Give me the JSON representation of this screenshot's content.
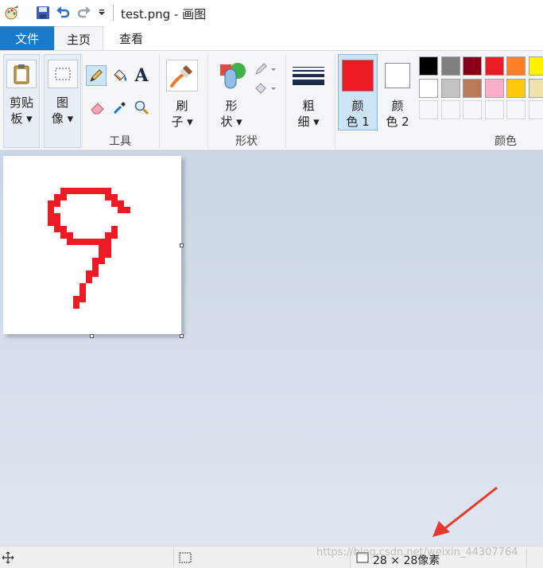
{
  "window": {
    "title": "test.png - 画图"
  },
  "tabs": {
    "file": "文件",
    "home": "主页",
    "view": "查看"
  },
  "ribbon": {
    "clipboard": {
      "label_line1": "剪贴",
      "label_line2": "板"
    },
    "image": {
      "label_line1": "图",
      "label_line2": "像"
    },
    "tools": {
      "group_label": "工具"
    },
    "brushes": {
      "label_line1": "刷",
      "label_line2": "子"
    },
    "shapes": {
      "label_line1": "形",
      "label_line2": "状",
      "group_label": "形状"
    },
    "size": {
      "label_line1": "粗",
      "label_line2": "细"
    },
    "color1": {
      "label_line1": "颜",
      "label_line2": "色 1",
      "color": "#ed1c24"
    },
    "color2": {
      "label_line1": "颜",
      "label_line2": "色 2",
      "color": "#ffffff"
    },
    "colors": {
      "group_label": "颜色",
      "row1": [
        "#000000",
        "#7f7f7f",
        "#880015",
        "#ed1c24",
        "#ff7f27",
        "#fff200"
      ],
      "row2": [
        "#ffffff",
        "#c3c3c3",
        "#b97a57",
        "#ffaec9",
        "#ffc90e",
        "#efe4b0"
      ]
    }
  },
  "canvas": {
    "stroke_color": "#ed1c24"
  },
  "status": {
    "image_size": "28 × 28像素",
    "watermark": "https://blog.csdn.net/weixin_44307764"
  }
}
